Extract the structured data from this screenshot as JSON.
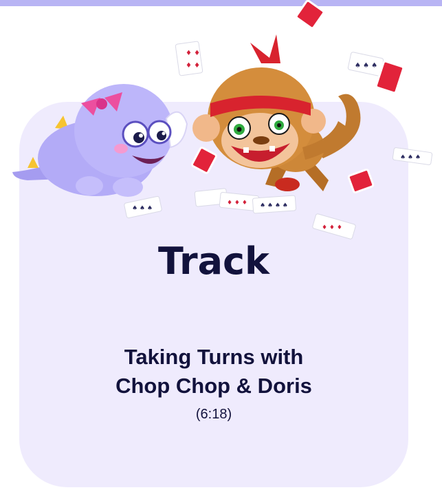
{
  "header": {
    "accent_color": "#b8b4f4"
  },
  "card": {
    "background_color": "#efebfd",
    "title": "Track",
    "subtitle_line1": "Taking Turns with",
    "subtitle_line2": "Chop Chop & Doris",
    "duration": "(6:18)",
    "text_color": "#12123c"
  },
  "illustration": {
    "characters": [
      "doris-dinosaur-character",
      "chop-chop-monkey-character"
    ],
    "props": [
      "playing-cards"
    ]
  }
}
